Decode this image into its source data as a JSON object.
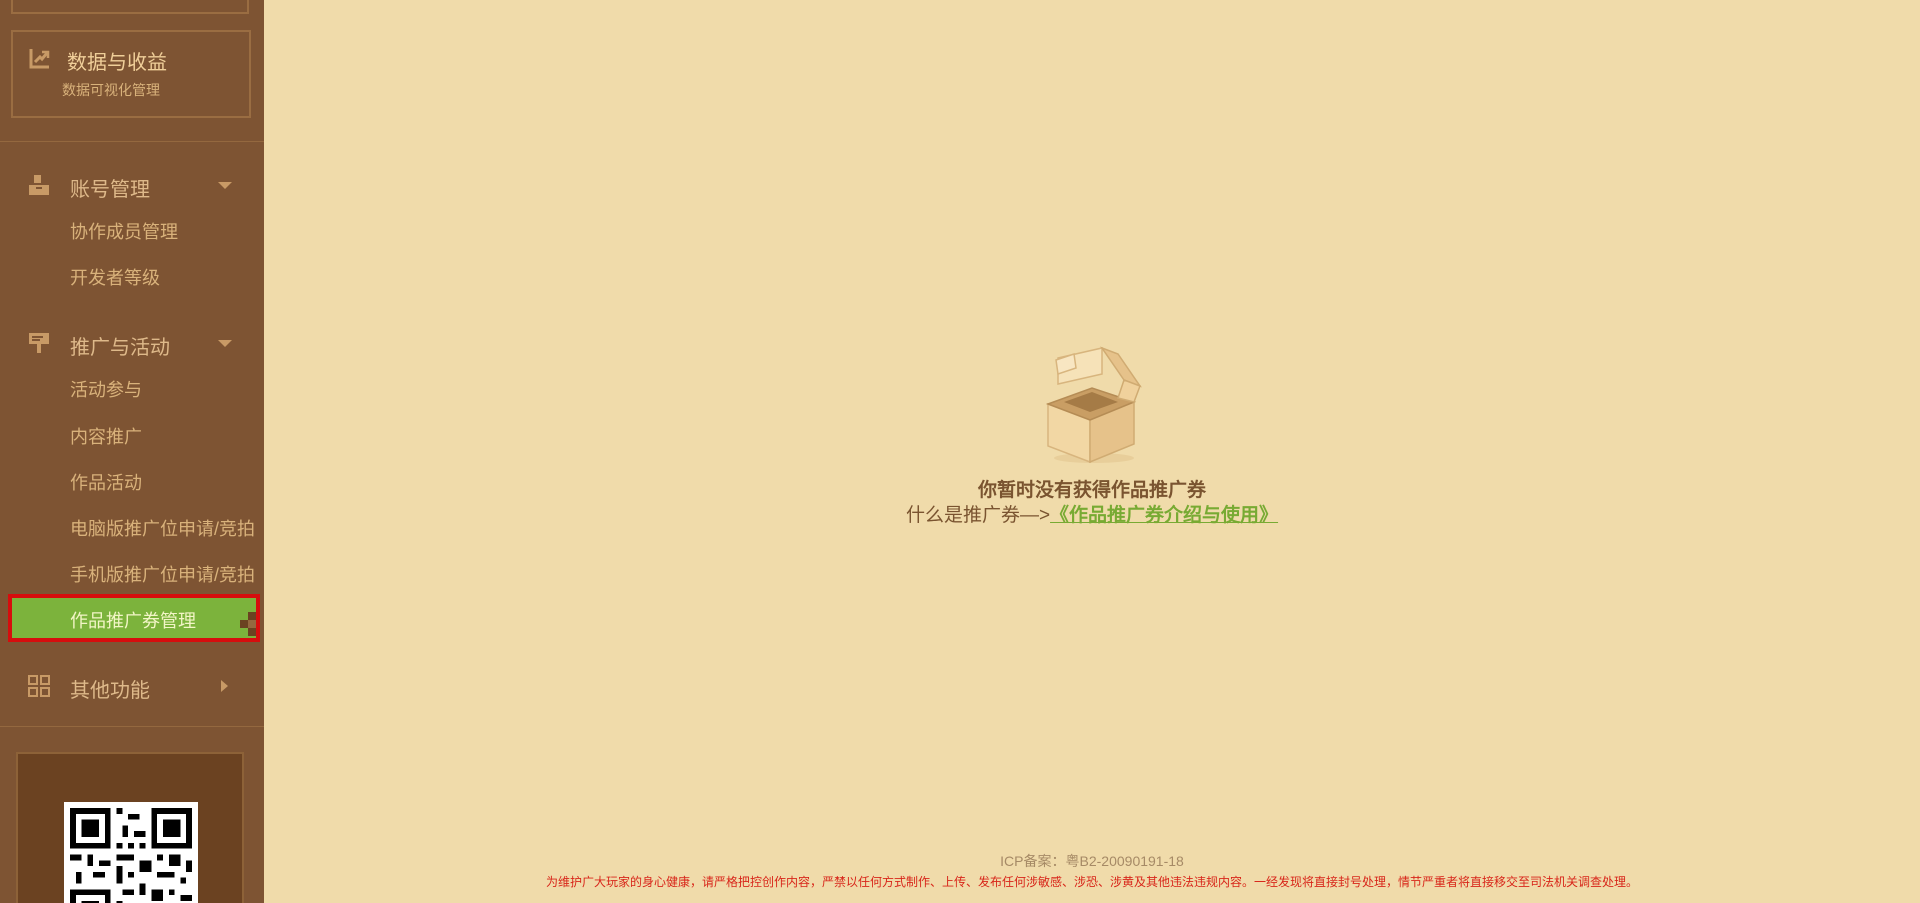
{
  "sidebar": {
    "data_card": {
      "title": "数据与收益",
      "subtitle": "数据可视化管理",
      "icon": "chart-trend-icon"
    },
    "groups": [
      {
        "label": "账号管理",
        "icon": "account-icon",
        "expanded": true,
        "items": [
          {
            "label": "协作成员管理"
          },
          {
            "label": "开发者等级"
          }
        ]
      },
      {
        "label": "推广与活动",
        "icon": "signboard-icon",
        "expanded": true,
        "items": [
          {
            "label": "活动参与"
          },
          {
            "label": "内容推广"
          },
          {
            "label": "作品活动"
          },
          {
            "label": "电脑版推广位申请/竞拍"
          },
          {
            "label": "手机版推广位申请/竞拍"
          },
          {
            "label": "作品推广券管理",
            "active": true
          }
        ]
      },
      {
        "label": "其他功能",
        "icon": "grid-icon",
        "expanded": false,
        "items": []
      }
    ]
  },
  "main": {
    "empty_title": "你暂时没有获得作品推广券",
    "empty_desc_prefix": "什么是推广券—>",
    "empty_link": "《作品推广券介绍与使用》"
  },
  "footer": {
    "icp": "ICP备案：粤B2-20090191-18",
    "notice": "为维护广大玩家的身心健康，请严格把控创作内容，严禁以任何方式制作、上传、发布任何涉敏感、涉恐、涉黄及其他违法违规内容。一经发现将直接封号处理，情节严重者将直接移交至司法机关调查处理。"
  },
  "colors": {
    "sidebar_bg": "#7e5433",
    "page_bg": "#f0dbaa",
    "active_bg": "#7cb33c",
    "active_border": "#d60d0d",
    "link": "#78aa33"
  }
}
